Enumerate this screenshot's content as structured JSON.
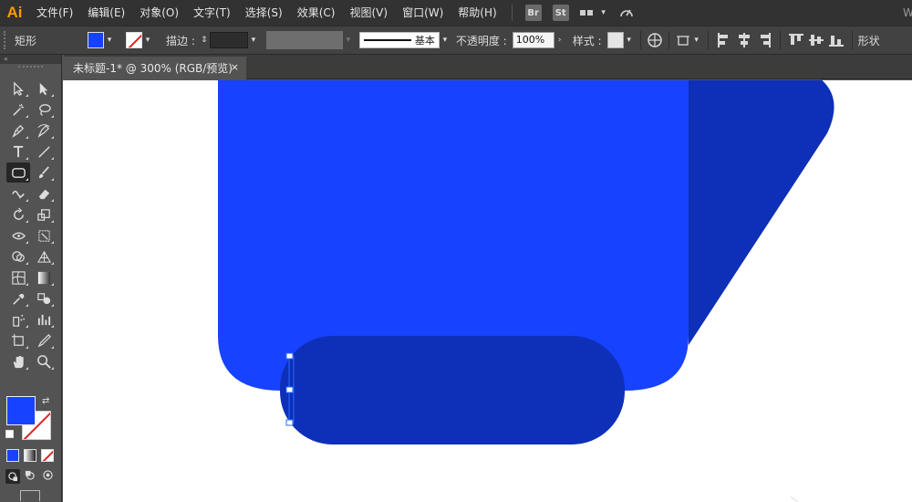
{
  "app": {
    "logo": "Ai",
    "menus": [
      "文件(F)",
      "编辑(E)",
      "对象(O)",
      "文字(T)",
      "选择(S)",
      "效果(C)",
      "视图(V)",
      "窗口(W)",
      "帮助(H)"
    ],
    "bridge_badge": "Br",
    "stock_badge": "St"
  },
  "control_bar": {
    "object_type": "矩形",
    "stroke_label": "描边 :",
    "stroke_style": "基本",
    "opacity_label": "不透明度 :",
    "opacity_value": "100%",
    "style_label": "样式 :",
    "shape_label": "形状"
  },
  "document": {
    "tab_title": "未标题-1* @ 300% (RGB/预览)",
    "close_glyph": "×"
  },
  "colors": {
    "fill": "#1742ff",
    "dark_blue": "#0e2fb8",
    "stroke_none_slash": "#e02020",
    "selection": "#2b6bff"
  },
  "tools": [
    [
      "selection-tool-icon",
      "direct-selection-tool-icon"
    ],
    [
      "magic-wand-tool-icon",
      "lasso-tool-icon"
    ],
    [
      "pen-tool-icon",
      "curvature-tool-icon"
    ],
    [
      "type-tool-icon",
      "line-segment-tool-icon"
    ],
    [
      "rectangle-tool-icon",
      "paintbrush-tool-icon"
    ],
    [
      "shaper-tool-icon",
      "eraser-tool-icon"
    ],
    [
      "rotate-tool-icon",
      "scale-tool-icon"
    ],
    [
      "width-tool-icon",
      "free-transform-tool-icon"
    ],
    [
      "shape-builder-tool-icon",
      "perspective-grid-tool-icon"
    ],
    [
      "mesh-tool-icon",
      "gradient-tool-icon"
    ],
    [
      "eyedropper-tool-icon",
      "blend-tool-icon"
    ],
    [
      "symbol-sprayer-tool-icon",
      "column-graph-tool-icon"
    ],
    [
      "artboard-tool-icon",
      "slice-tool-icon"
    ],
    [
      "hand-tool-icon",
      "zoom-tool-icon"
    ]
  ]
}
